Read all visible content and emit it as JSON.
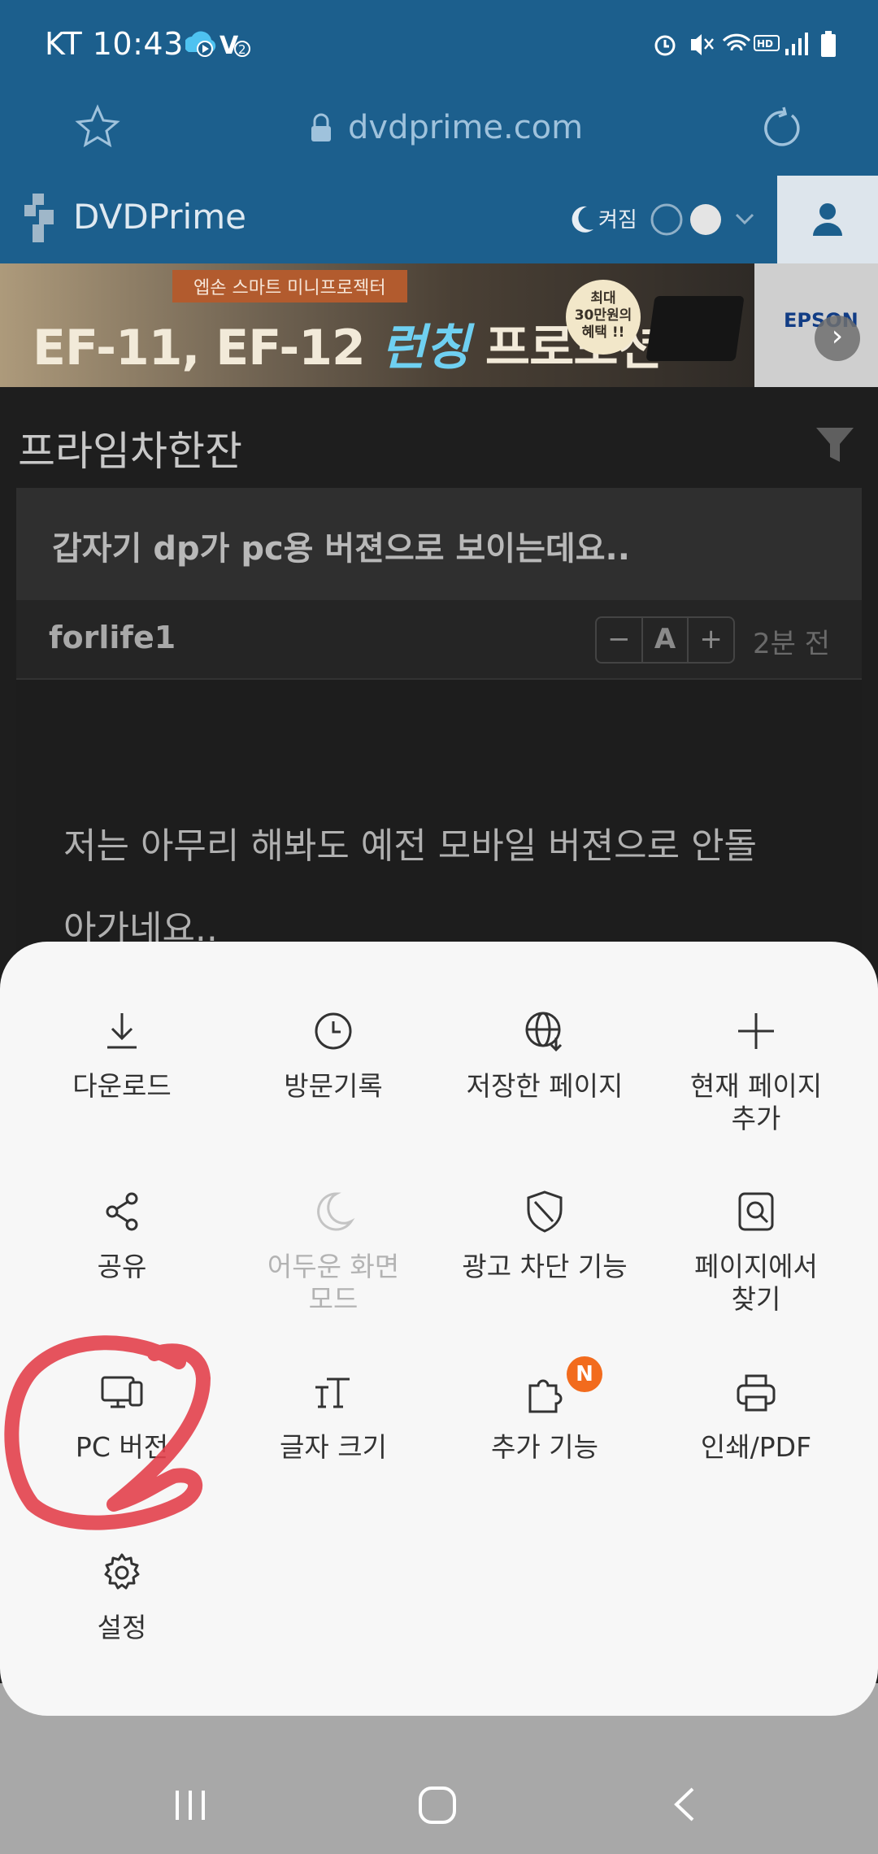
{
  "status": {
    "carrier_time": "KT 10:43"
  },
  "browser": {
    "url": "dvdprime.com"
  },
  "site": {
    "brand": "DVDPrime",
    "night_mode_label": "켜짐"
  },
  "banner": {
    "subtitle": "엡손 스마트 미니프로젝터",
    "title_left": "EF-11, EF-12 ",
    "title_highlight": "런칭",
    "title_right": " 프로모션",
    "badge_line1": "최대",
    "badge_line2": "30만원의",
    "badge_line3": "혜택 !!",
    "brand": "EPSON"
  },
  "page": {
    "section_title": "프라임차한잔",
    "post_title": "갑자기 dp가 pc용 버젼으로 보이는데요..",
    "author": "forlife1",
    "font_minus": "−",
    "font_a": "A",
    "font_plus": "+",
    "time": "2분 전",
    "body_line1": "저는 아무리 해봐도 예전 모바일 버젼으로 안돌",
    "body_line2": "아가네요.."
  },
  "menu": {
    "download": "다운로드",
    "history": "방문기록",
    "saved_pages": "저장한 페이지",
    "add_page_1": "현재 페이지",
    "add_page_2": "추가",
    "share": "공유",
    "dark_mode_1": "어두운 화면",
    "dark_mode_2": "모드",
    "ad_block": "광고 차단 기능",
    "find_1": "페이지에서",
    "find_2": "찾기",
    "pc_version": "PC 버전",
    "font_size": "글자 크기",
    "addons": "추가 기능",
    "addons_badge": "N",
    "print_pdf": "인쇄/PDF",
    "settings": "설정"
  },
  "colors": {
    "header_blue": "#1c5f8d",
    "sheet_bg": "#f7f7f7",
    "annotation_red": "#e2404b",
    "badge_orange": "#f26b1d"
  }
}
